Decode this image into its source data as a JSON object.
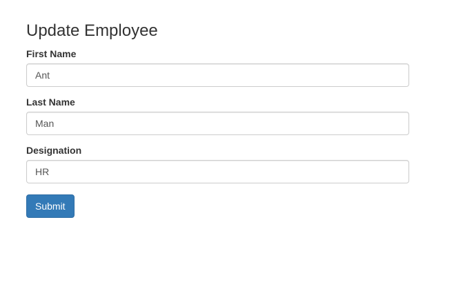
{
  "form": {
    "title": "Update Employee",
    "fields": [
      {
        "label": "First Name",
        "value": "Ant"
      },
      {
        "label": "Last Name",
        "value": "Man"
      },
      {
        "label": "Designation",
        "value": "HR"
      }
    ],
    "submit_label": "Submit"
  },
  "colors": {
    "primary": "#337ab7",
    "border": "#cccccc",
    "text": "#333333"
  }
}
